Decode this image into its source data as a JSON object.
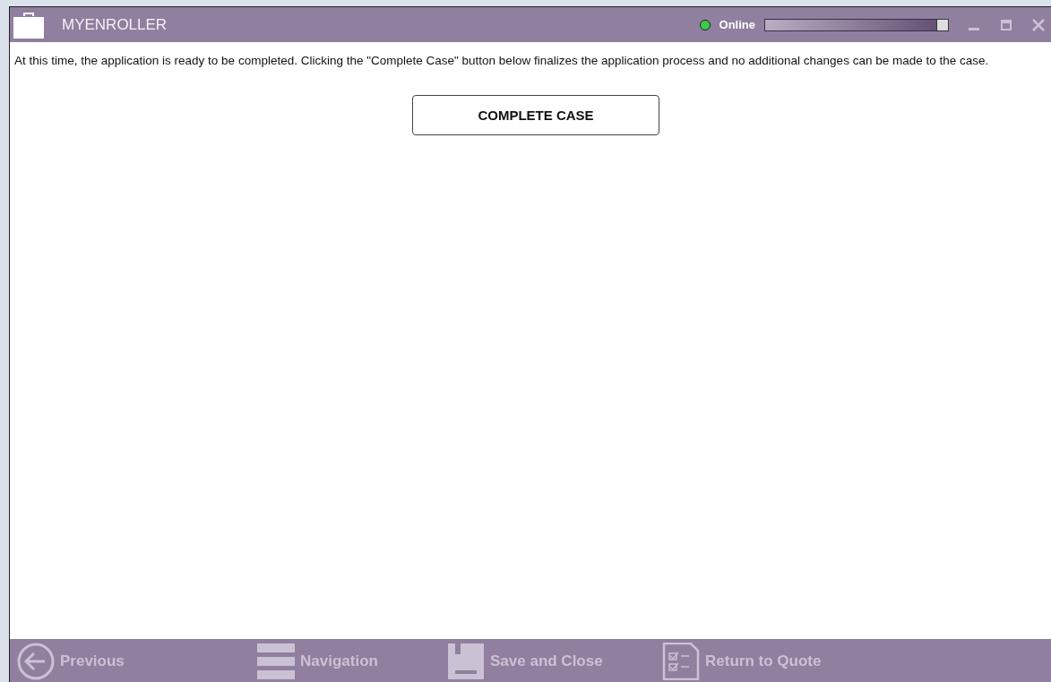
{
  "window": {
    "title": "MYENROLLER",
    "status": {
      "label": "Online",
      "color": "#3ccc4a"
    },
    "progress": {
      "level": 1
    }
  },
  "message": "At this time, the application is ready to be completed. Clicking the \"Complete Case\" button below finalizes the application process and no additional changes can be made to the case.",
  "primary_button": "COMPLETE CASE",
  "footer": [
    {
      "kind": "previous",
      "label": "Previous"
    },
    {
      "kind": "navigation",
      "label": "Navigation"
    },
    {
      "kind": "save",
      "label": "Save and Close"
    },
    {
      "kind": "quote",
      "label": "Return to Quote"
    }
  ]
}
